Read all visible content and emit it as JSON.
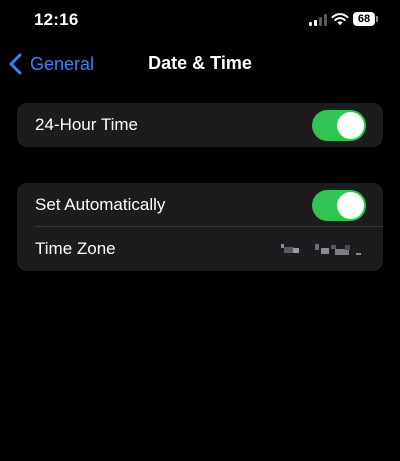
{
  "status_bar": {
    "time": "12:16",
    "battery_level": "68",
    "icons": [
      "signal-icon",
      "wifi-icon",
      "battery-icon"
    ]
  },
  "nav": {
    "back_label": "General",
    "back_icon": "chevron-left-icon",
    "title": "Date & Time"
  },
  "settings": {
    "hour24": {
      "label": "24-Hour Time",
      "enabled": true
    },
    "set_automatically": {
      "label": "Set Automatically",
      "enabled": true
    },
    "time_zone": {
      "label": "Time Zone",
      "value_redacted": true
    }
  },
  "colors": {
    "background": "#000000",
    "group_background": "#1c1c1e",
    "accent_blue": "#3b82f0",
    "toggle_on": "#30c553",
    "separator": "#38383a"
  }
}
